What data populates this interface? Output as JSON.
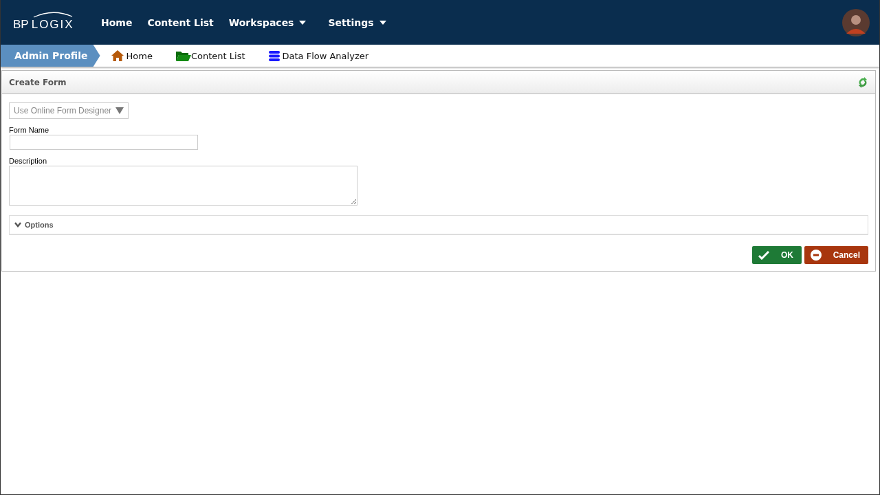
{
  "logo": {
    "brand": "BP",
    "name": "LOGIX"
  },
  "nav": [
    {
      "label": "Home",
      "dropdown": false
    },
    {
      "label": "Content List",
      "dropdown": false
    },
    {
      "label": "Workspaces",
      "dropdown": true
    },
    {
      "label": "Settings",
      "dropdown": true
    }
  ],
  "breadcrumbs": [
    {
      "label": "Admin Profile",
      "kind": "profile"
    },
    {
      "label": "Home",
      "kind": "home"
    },
    {
      "label": "Content List",
      "kind": "folder"
    },
    {
      "label": "Data Flow Analyzer",
      "kind": "database"
    }
  ],
  "panel": {
    "title": "Create Form",
    "designer_select": {
      "value": "Use Online Form Designer"
    },
    "fields": [
      {
        "label": "Form Name",
        "kind": "text"
      },
      {
        "label": "Description",
        "kind": "textarea"
      }
    ],
    "options": {
      "label": "Options",
      "expanded": false
    },
    "buttons": [
      {
        "label": "OK",
        "kind": "ok"
      },
      {
        "label": "Cancel",
        "kind": "cancel"
      }
    ]
  }
}
